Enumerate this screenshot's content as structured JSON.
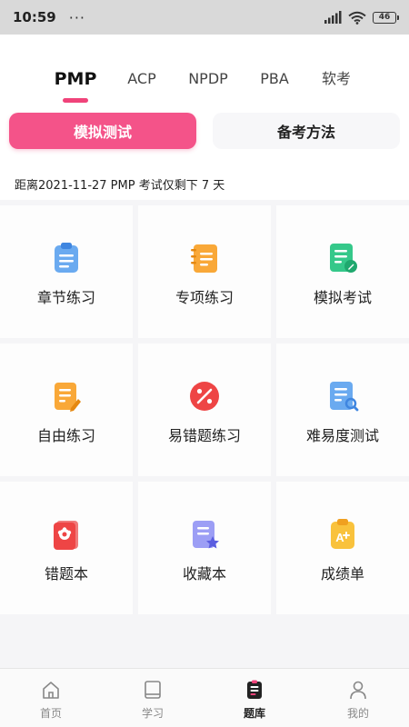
{
  "status_bar": {
    "time": "10:59",
    "dots": "···",
    "battery": "46"
  },
  "tabs": [
    {
      "label": "PMP",
      "active": true
    },
    {
      "label": "ACP",
      "active": false
    },
    {
      "label": "NPDP",
      "active": false
    },
    {
      "label": "PBA",
      "active": false
    },
    {
      "label": "软考",
      "active": false
    }
  ],
  "mode_buttons": {
    "mock_test": "模拟测试",
    "study_method": "备考方法"
  },
  "countdown": "距离2021-11-27 PMP 考试仅剩下 7 天",
  "grid": [
    {
      "label": "章节练习",
      "icon": "clipboard-list-icon"
    },
    {
      "label": "专项练习",
      "icon": "notebook-icon"
    },
    {
      "label": "模拟考试",
      "icon": "document-edit-icon"
    },
    {
      "label": "自由练习",
      "icon": "document-pencil-icon"
    },
    {
      "label": "易错题练习",
      "icon": "percent-icon"
    },
    {
      "label": "难易度测试",
      "icon": "document-search-icon"
    },
    {
      "label": "错题本",
      "icon": "error-book-icon"
    },
    {
      "label": "收藏本",
      "icon": "favorite-book-icon"
    },
    {
      "label": "成绩单",
      "icon": "grade-report-icon"
    }
  ],
  "bottom_nav": [
    {
      "label": "首页",
      "icon": "home-icon"
    },
    {
      "label": "学习",
      "icon": "book-icon"
    },
    {
      "label": "题库",
      "icon": "question-bank-icon",
      "active": true
    },
    {
      "label": "我的",
      "icon": "profile-icon"
    }
  ],
  "colors": {
    "accent": "#f0437a",
    "button_pink": "#f45389"
  }
}
